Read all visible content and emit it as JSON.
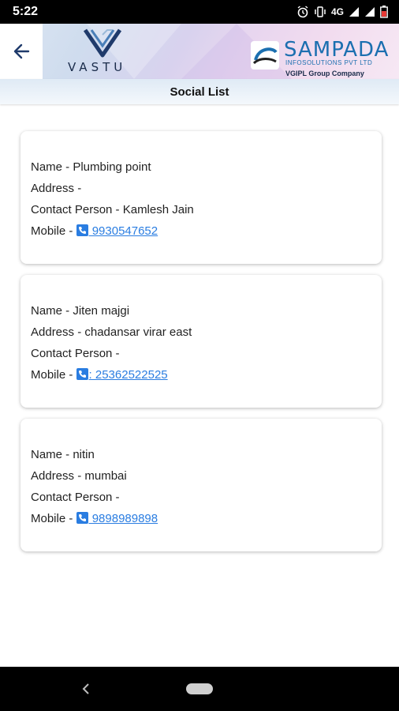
{
  "status_bar": {
    "time": "5:22",
    "network": "4G"
  },
  "header": {
    "app_logo_text": "VASTU",
    "company_name": "SAMPADA",
    "company_subtitle": "INFOSOLUTIONS PVT LTD",
    "company_group": "VGIPL Group Company"
  },
  "title": "Social List",
  "contacts": [
    {
      "name": "Name - Plumbing point",
      "address": "Address -",
      "contact_person": "Contact Person - Kamlesh Jain",
      "mobile_label": "Mobile -",
      "mobile": " 9930547652"
    },
    {
      "name": "Name - Jiten majgi",
      "address": "Address - chadansar virar east",
      "contact_person": "Contact Person -",
      "mobile_label": "Mobile -",
      "mobile": ": 25362522525"
    },
    {
      "name": "Name - nitin",
      "address": "Address - mumbai",
      "contact_person": "Contact Person -",
      "mobile_label": "Mobile -",
      "mobile": " 9898989898"
    }
  ],
  "colors": {
    "link": "#2a7de1",
    "brand_blue": "#1b6fb0"
  }
}
